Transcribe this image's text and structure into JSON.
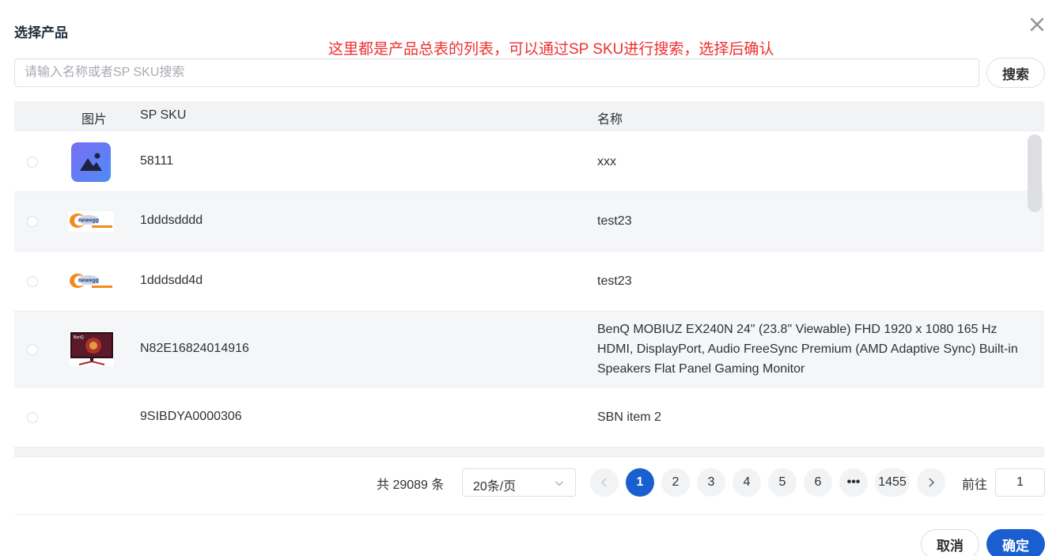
{
  "dialog": {
    "title": "选择产品",
    "close_icon": "close-icon"
  },
  "annotation": {
    "text": "这里都是产品总表的列表，可以通过SP SKU进行搜索，选择后确认",
    "color": "#ef2f2f"
  },
  "search": {
    "placeholder": "请输入名称或者SP SKU搜索",
    "value": "",
    "button_label": "搜索"
  },
  "table": {
    "columns": [
      "图片",
      "SP SKU",
      "名称"
    ],
    "rows": [
      {
        "image": "image-placeholder-icon",
        "sku": "58111",
        "name": "xxx"
      },
      {
        "image": "newegg-logo",
        "sku": "1dddsdddd",
        "name": "test23"
      },
      {
        "image": "newegg-logo",
        "sku": "1dddsdd4d",
        "name": "test23"
      },
      {
        "image": "benq-monitor-photo",
        "sku": "N82E16824014916",
        "name": "BenQ MOBIUZ EX240N 24\" (23.8\" Viewable) FHD 1920 x 1080 165 Hz HDMI, DisplayPort, Audio FreeSync Premium (AMD Adaptive Sync) Built-in Speakers Flat Panel Gaming Monitor"
      },
      {
        "image": "",
        "sku": "9SIBDYA0000306",
        "name": "SBN item 2"
      }
    ]
  },
  "pagination": {
    "total_label": "共 29089 条",
    "page_size_label": "20条/页",
    "pages": [
      "1",
      "2",
      "3",
      "4",
      "5",
      "6",
      "•••",
      "1455"
    ],
    "current_page": "1",
    "goto_label": "前往",
    "goto_value": "1"
  },
  "footer": {
    "cancel_label": "取消",
    "confirm_label": "确定"
  },
  "colors": {
    "primary": "#1a5fd0",
    "annotation": "#ef2f2f",
    "header_bg": "#f2f3f5"
  }
}
